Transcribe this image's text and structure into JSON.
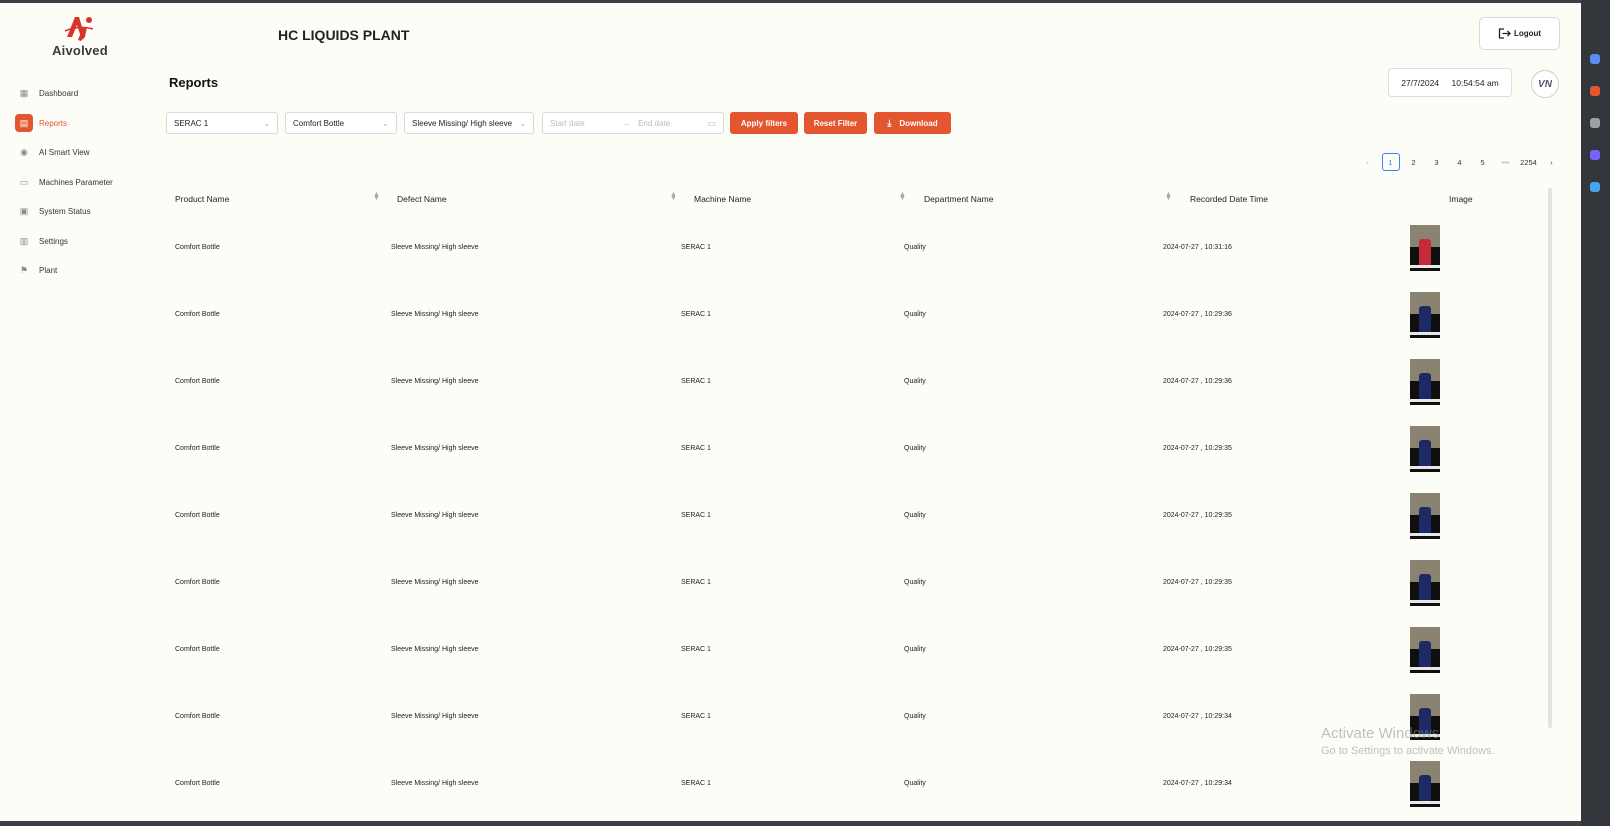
{
  "brand": {
    "name": "Aivolved",
    "logo_mark": "Ai",
    "accent": "#e4562f"
  },
  "sidebar": {
    "items": [
      {
        "label": "Dashboard",
        "icon": "dashboard-icon",
        "active": false
      },
      {
        "label": "Reports",
        "icon": "reports-icon",
        "active": true
      },
      {
        "label": "AI Smart View",
        "icon": "eye-icon",
        "active": false
      },
      {
        "label": "Machines Parameter",
        "icon": "machine-icon",
        "active": false
      },
      {
        "label": "System Status",
        "icon": "monitor-icon",
        "active": false
      },
      {
        "label": "Settings",
        "icon": "settings-icon",
        "active": false
      },
      {
        "label": "Plant",
        "icon": "flag-icon",
        "active": false
      }
    ]
  },
  "header": {
    "plant_title": "HC LIQUIDS PLANT",
    "logout_label": "Logout",
    "date": "27/7/2024",
    "time": "10:54:54 am",
    "avatar_initials": "VN"
  },
  "page": {
    "title": "Reports"
  },
  "filters": {
    "machine": "SERAC 1",
    "product": "Comfort Bottle",
    "defect": "Sleeve Missing/ High sleeve",
    "start_placeholder": "Start date",
    "end_placeholder": "End date",
    "apply_label": "Apply filters",
    "reset_label": "Reset Filter",
    "download_label": "Download"
  },
  "pagination": {
    "pages": [
      "1",
      "2",
      "3",
      "4",
      "5"
    ],
    "ellipsis": "•••",
    "last": "2254",
    "current": "1"
  },
  "table": {
    "columns": [
      "Product Name",
      "Defect Name",
      "Machine Name",
      "Department Name",
      "Recorded Date Time",
      "Image"
    ],
    "rows": [
      {
        "product": "Comfort Bottle",
        "defect": "Sleeve Missing/ High sleeve",
        "machine": "SERAC 1",
        "department": "Quality",
        "recorded": "2024-07-27 , 10:31:16"
      },
      {
        "product": "Comfort Bottle",
        "defect": "Sleeve Missing/ High sleeve",
        "machine": "SERAC 1",
        "department": "Quality",
        "recorded": "2024-07-27 , 10:29:36"
      },
      {
        "product": "Comfort Bottle",
        "defect": "Sleeve Missing/ High sleeve",
        "machine": "SERAC 1",
        "department": "Quality",
        "recorded": "2024-07-27 , 10:29:36"
      },
      {
        "product": "Comfort Bottle",
        "defect": "Sleeve Missing/ High sleeve",
        "machine": "SERAC 1",
        "department": "Quality",
        "recorded": "2024-07-27 , 10:29:35"
      },
      {
        "product": "Comfort Bottle",
        "defect": "Sleeve Missing/ High sleeve",
        "machine": "SERAC 1",
        "department": "Quality",
        "recorded": "2024-07-27 , 10:29:35"
      },
      {
        "product": "Comfort Bottle",
        "defect": "Sleeve Missing/ High sleeve",
        "machine": "SERAC 1",
        "department": "Quality",
        "recorded": "2024-07-27 , 10:29:35"
      },
      {
        "product": "Comfort Bottle",
        "defect": "Sleeve Missing/ High sleeve",
        "machine": "SERAC 1",
        "department": "Quality",
        "recorded": "2024-07-27 , 10:29:35"
      },
      {
        "product": "Comfort Bottle",
        "defect": "Sleeve Missing/ High sleeve",
        "machine": "SERAC 1",
        "department": "Quality",
        "recorded": "2024-07-27 , 10:29:34"
      },
      {
        "product": "Comfort Bottle",
        "defect": "Sleeve Missing/ High sleeve",
        "machine": "SERAC 1",
        "department": "Quality",
        "recorded": "2024-07-27 , 10:29:34"
      }
    ]
  },
  "watermark": {
    "line1": "Activate Windows",
    "line2": "Go to Settings to activate Windows."
  }
}
